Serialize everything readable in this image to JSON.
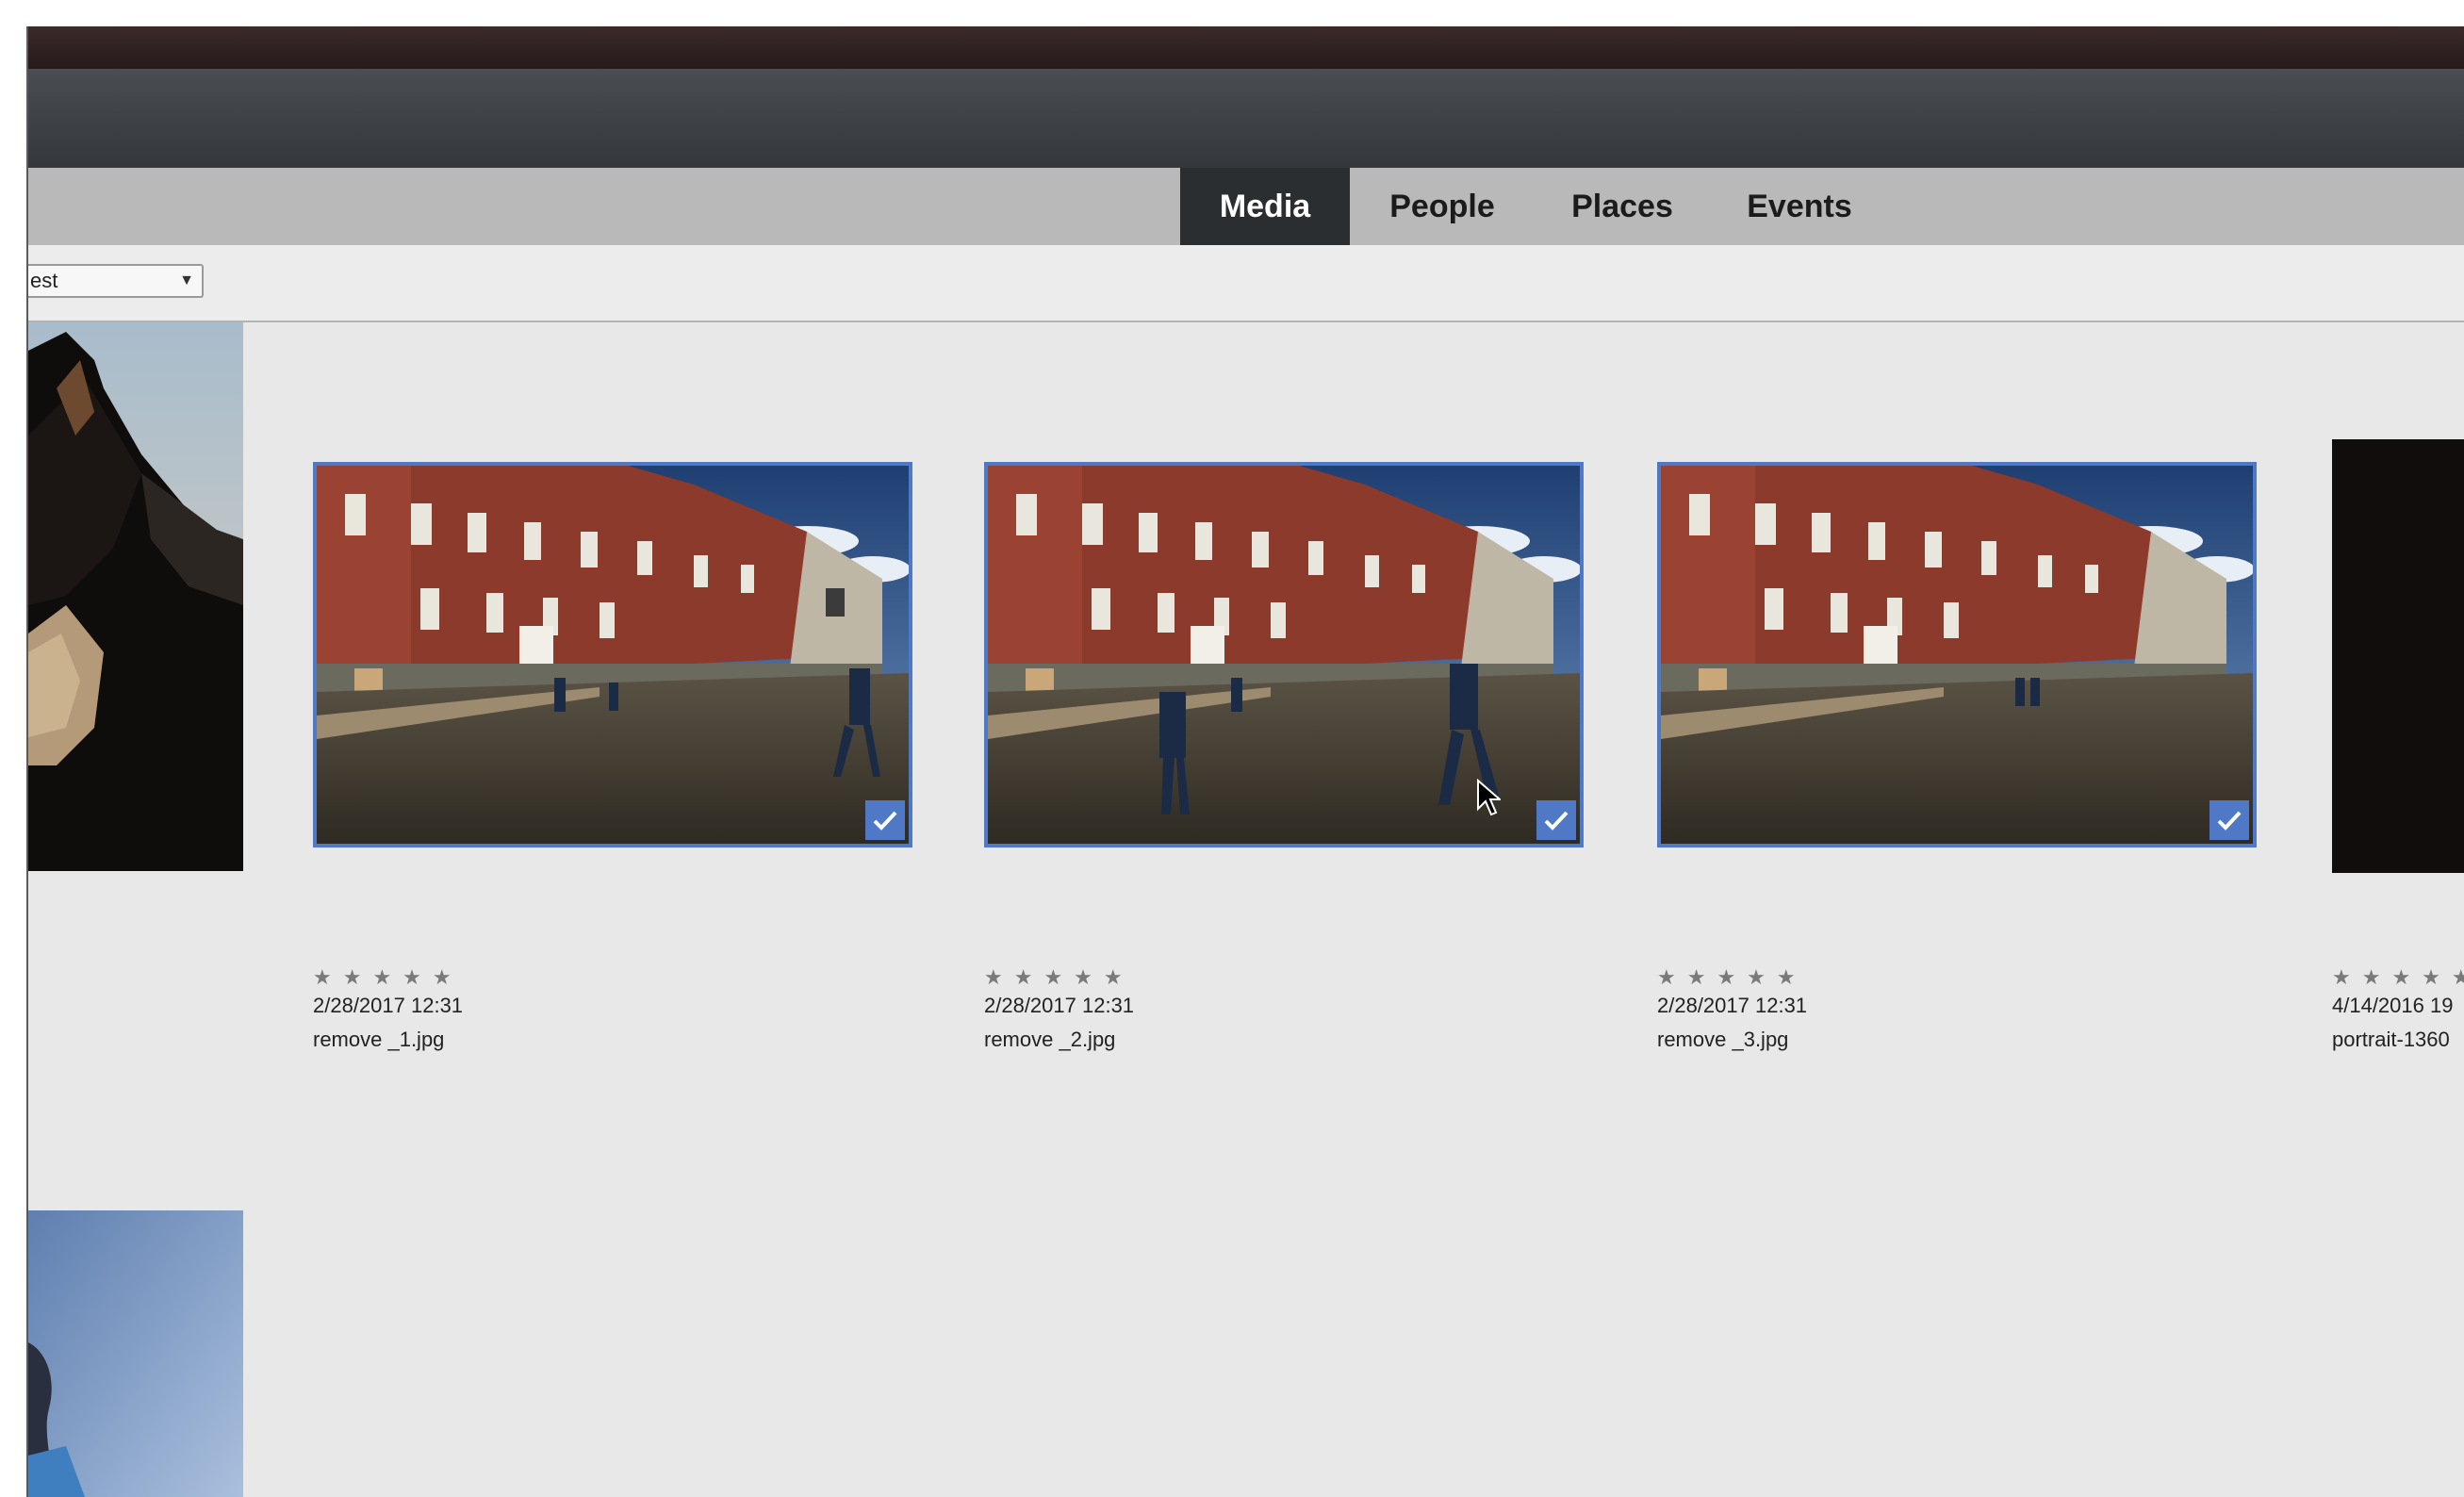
{
  "tabs": [
    {
      "label": "Media",
      "active": true
    },
    {
      "label": "People",
      "active": false
    },
    {
      "label": "Places",
      "active": false
    },
    {
      "label": "Events",
      "active": false
    }
  ],
  "sort": {
    "value": "est"
  },
  "rating_glyph": "★",
  "items": [
    {
      "rating_stars": "★★★★★",
      "date": "2/28/2017 12:31",
      "filename": "remove _1.jpg",
      "selected": true
    },
    {
      "rating_stars": "★★★★★",
      "date": "2/28/2017 12:31",
      "filename": "remove _2.jpg",
      "selected": true
    },
    {
      "rating_stars": "★★★★★",
      "date": "2/28/2017 12:31",
      "filename": "remove _3.jpg",
      "selected": true
    },
    {
      "rating_stars": "★★★★★",
      "date": "4/14/2016 19",
      "filename": "portrait-1360",
      "selected": false
    }
  ],
  "colors": {
    "selection": "#4f78c6",
    "active_tab": "#2b2e31",
    "tabbar": "#b9b9b9",
    "background": "#e8e8e8"
  }
}
